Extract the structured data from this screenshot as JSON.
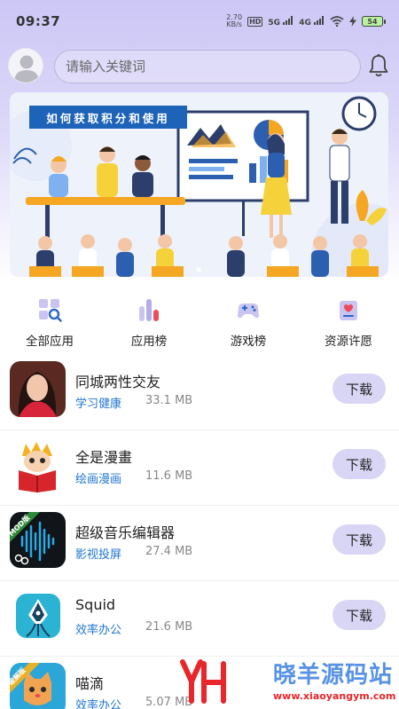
{
  "status_bar": {
    "time": "09:37",
    "net_speed_value": "2.70",
    "net_speed_unit": "KB/s",
    "hd": "HD",
    "hd_sub": "1",
    "signal1": "5G",
    "signal2": "4G",
    "battery": "54"
  },
  "search": {
    "placeholder": "请输入关键词"
  },
  "banner": {
    "title": "如何获取积分和使用"
  },
  "categories": [
    {
      "label": "全部应用",
      "icon": "grid-search-icon"
    },
    {
      "label": "应用榜",
      "icon": "bar-chart-icon"
    },
    {
      "label": "游戏榜",
      "icon": "gamepad-icon"
    },
    {
      "label": "资源许愿",
      "icon": "wish-card-icon"
    }
  ],
  "apps": [
    {
      "name": "同城两性交友",
      "category": "学习健康",
      "size": "33.1 MB",
      "button": "下载"
    },
    {
      "name": "全是漫畫",
      "category": "绘画漫画",
      "size": "11.6 MB",
      "button": "下载"
    },
    {
      "name": "超级音乐编辑器",
      "category": "影视投屏",
      "size": "27.4 MB",
      "button": "下载",
      "badge": "MOD版"
    },
    {
      "name": "Squid",
      "category": "效率办公",
      "size": "21.6 MB",
      "button": "下载"
    },
    {
      "name": "喵滴",
      "category": "效率办公",
      "size": "5.07 MB",
      "button": "下载",
      "badge": "破解版"
    }
  ],
  "watermark": {
    "text": "晓羊源码站",
    "url": "www.xiaoyangym.com"
  },
  "colors": {
    "accent": "#2177d0",
    "button_bg": "#d9d6f5",
    "header_bg": "#ccc7f6"
  }
}
